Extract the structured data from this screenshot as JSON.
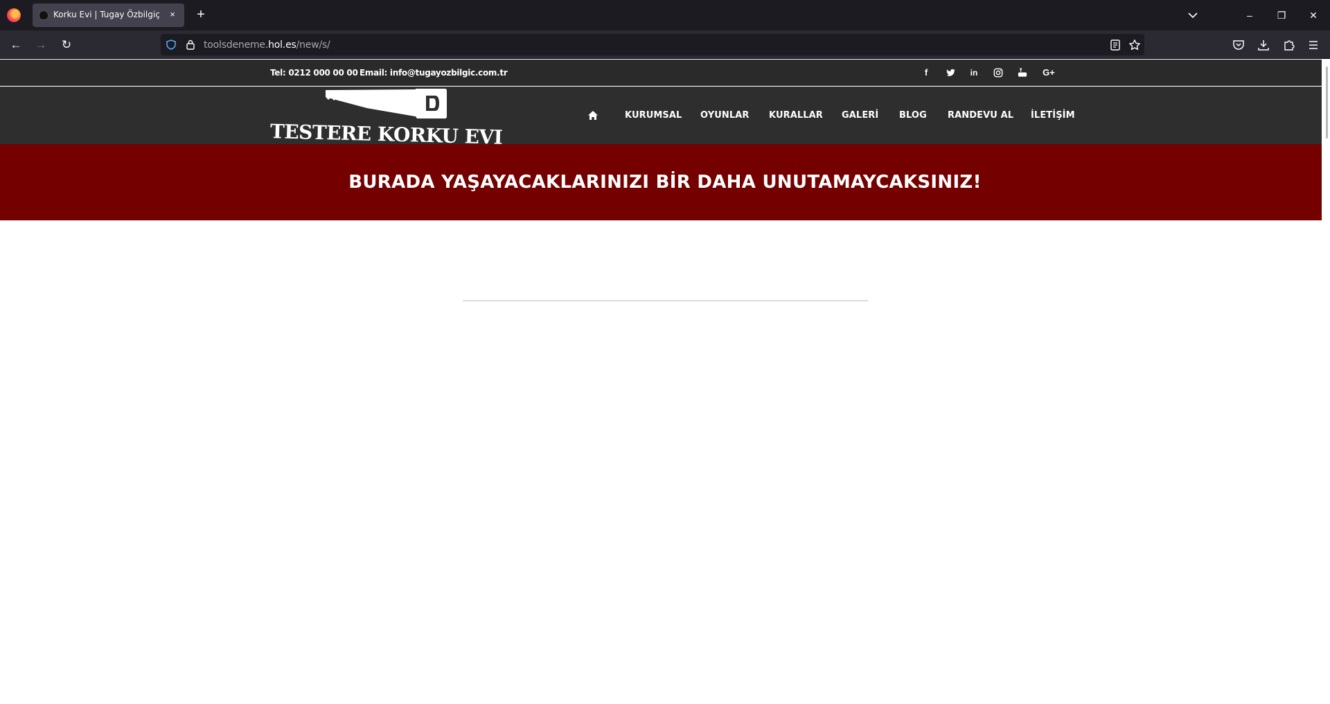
{
  "browser": {
    "tab_title": "Korku Evi | Tugay Özbilgiç",
    "tab_close": "×",
    "new_tab": "+",
    "url_path_prefix": "toolsdeneme.",
    "url_host": "hol.es",
    "url_path": "/new/s/",
    "minimize": "–",
    "restore": "❐",
    "close": "✕",
    "back": "←",
    "forward": "→",
    "reload": "↻"
  },
  "topbar": {
    "phone": "Tel: 0212 000 00 00",
    "email": "Email: info@tugayozbilgic.com.tr",
    "social": [
      {
        "icon": "facebook-icon",
        "glyph": "f"
      },
      {
        "icon": "twitter-icon",
        "glyph": "t"
      },
      {
        "icon": "linkedin-icon",
        "glyph": "in"
      },
      {
        "icon": "instagram-icon",
        "glyph": "◎"
      },
      {
        "icon": "youtube-icon",
        "glyph": "▶"
      },
      {
        "icon": "google-plus-icon",
        "glyph": "G+"
      }
    ]
  },
  "header": {
    "logo_text": "TESTERE  KORKU EVI",
    "menu": [
      {
        "label": "KURUMSAL"
      },
      {
        "label": "OYUNLAR"
      },
      {
        "label": "KURALLAR"
      },
      {
        "label": "GALERİ"
      },
      {
        "label": "BLOG"
      },
      {
        "label": "RANDEVU AL"
      },
      {
        "label": "İLETİŞİM"
      }
    ]
  },
  "banner": {
    "text": "BURADA YAŞAYACAKLARINIZI BİR DAHA UNUTAMAYCAKSINIZ!"
  },
  "colors": {
    "banner_bg": "#750000",
    "header_bg": "#2e2e2e",
    "topbar_bg": "#2a2a2a"
  }
}
